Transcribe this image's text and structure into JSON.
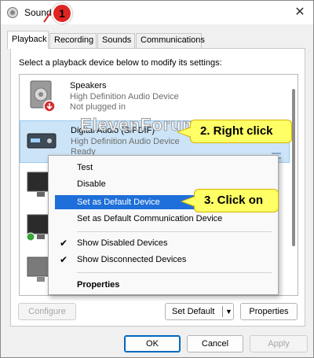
{
  "window": {
    "title": "Sound",
    "close_glyph": "✕"
  },
  "tabs": [
    {
      "label": "Playback",
      "active": true
    },
    {
      "label": "Recording"
    },
    {
      "label": "Sounds"
    },
    {
      "label": "Communications"
    }
  ],
  "instruction": "Select a playback device below to modify its settings:",
  "watermark": "ElevenForum.com",
  "devices": [
    {
      "name": "Speakers",
      "driver": "High Definition Audio Device",
      "status": "Not plugged in",
      "icon": "speaker-icon"
    },
    {
      "name": "Digital Audio (S/PDIF)",
      "driver": "High Definition Audio Device",
      "status": "Ready",
      "icon": "digital-audio-icon",
      "selected": true
    },
    {
      "icon": "monitor-icon"
    },
    {
      "icon": "monitor-icon"
    },
    {
      "icon": "monitor-icon"
    }
  ],
  "context_menu": {
    "items": [
      {
        "label": "Test"
      },
      {
        "label": "Disable"
      },
      {
        "label": "Set as Default Device",
        "highlighted": true
      },
      {
        "label": "Set as Default Communication Device"
      },
      {
        "label": "Show Disabled Devices",
        "checked": true
      },
      {
        "label": "Show Disconnected Devices",
        "checked": true
      },
      {
        "label": "Properties",
        "bold": true
      }
    ],
    "check_glyph": "✔"
  },
  "callouts": {
    "step1": "1",
    "step2": "2. Right click",
    "step3": "3. Click on"
  },
  "buttons": {
    "configure": "Configure",
    "set_default": "Set Default",
    "set_default_arrow": "▼",
    "properties": "Properties",
    "ok": "OK",
    "cancel": "Cancel",
    "apply": "Apply"
  },
  "colors": {
    "selection": "#cce4f7",
    "menu_highlight": "#1e6fd9",
    "callout": "#ffff66",
    "badge": "#e02424"
  }
}
